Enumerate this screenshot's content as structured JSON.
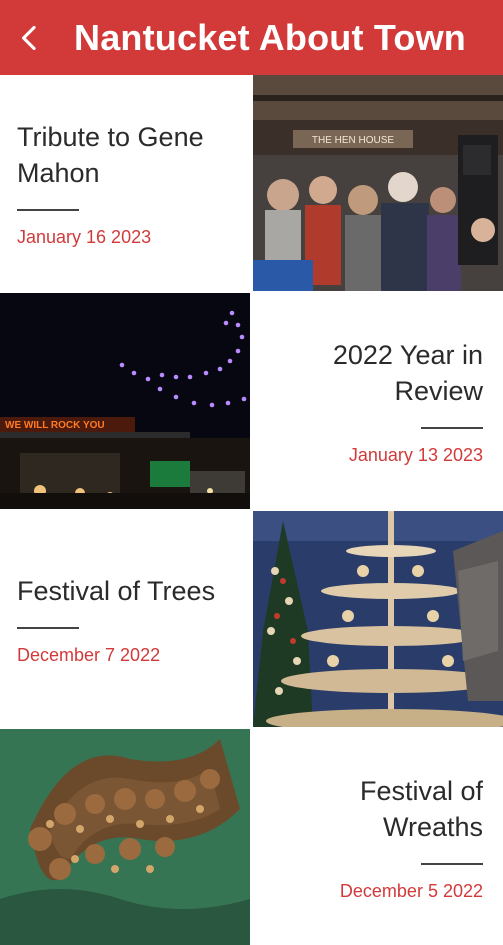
{
  "header": {
    "title": "Nantucket About Town"
  },
  "events": [
    {
      "title": "Tribute to Gene Mahon",
      "date": "January 16 2023",
      "sign_text": "THE HEN HOUSE"
    },
    {
      "title": "2022 Year in Review",
      "date": "January 13 2023",
      "sign_text": "WE WILL ROCK YOU"
    },
    {
      "title": "Festival of Trees",
      "date": "December 7 2022"
    },
    {
      "title": "Festival of Wreaths",
      "date": "December 5 2022"
    }
  ],
  "colors": {
    "brand": "#d23a3a",
    "date": "#d23a3a",
    "title": "#2b2b2b"
  }
}
